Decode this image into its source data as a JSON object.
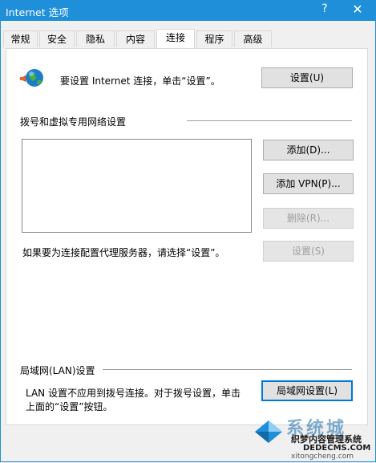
{
  "window": {
    "title": "Internet 选项",
    "help_glyph": "?",
    "close_glyph": "✕"
  },
  "tabs": [
    {
      "label": "常规",
      "active": false
    },
    {
      "label": "安全",
      "active": false
    },
    {
      "label": "隐私",
      "active": false
    },
    {
      "label": "内容",
      "active": false
    },
    {
      "label": "连接",
      "active": true
    },
    {
      "label": "程序",
      "active": false
    },
    {
      "label": "高级",
      "active": false
    }
  ],
  "setup": {
    "text": "要设置 Internet 连接，单击“设置”。",
    "button": "设置(U)",
    "icon": "globe-network-icon"
  },
  "dialup": {
    "heading": "拨号和虚拟专用网络设置",
    "add_button": "添加(D)...",
    "add_vpn_button": "添加 VPN(P)...",
    "remove_button": "删除(R)...",
    "proxy_text": "如果要为连接配置代理服务器，请选择“设置”。",
    "settings_button": "设置(S)"
  },
  "lan": {
    "heading": "局域网(LAN)设置",
    "text_line1": "LAN 设置不应用到拨号连接。对于拨号设置，单击",
    "text_line2": "上面的“设置”按钮。",
    "button": "局域网设置(L)"
  },
  "watermark": {
    "brand": "系统城",
    "line1": "织梦内容管理系统",
    "line2": "DEDECMS.COM",
    "line3": "xitongcheng.com"
  },
  "colors": {
    "titlebar": "#1e8fd8",
    "focus": "#0078d7",
    "panel": "#ffffff",
    "background": "#f0f0f0"
  }
}
